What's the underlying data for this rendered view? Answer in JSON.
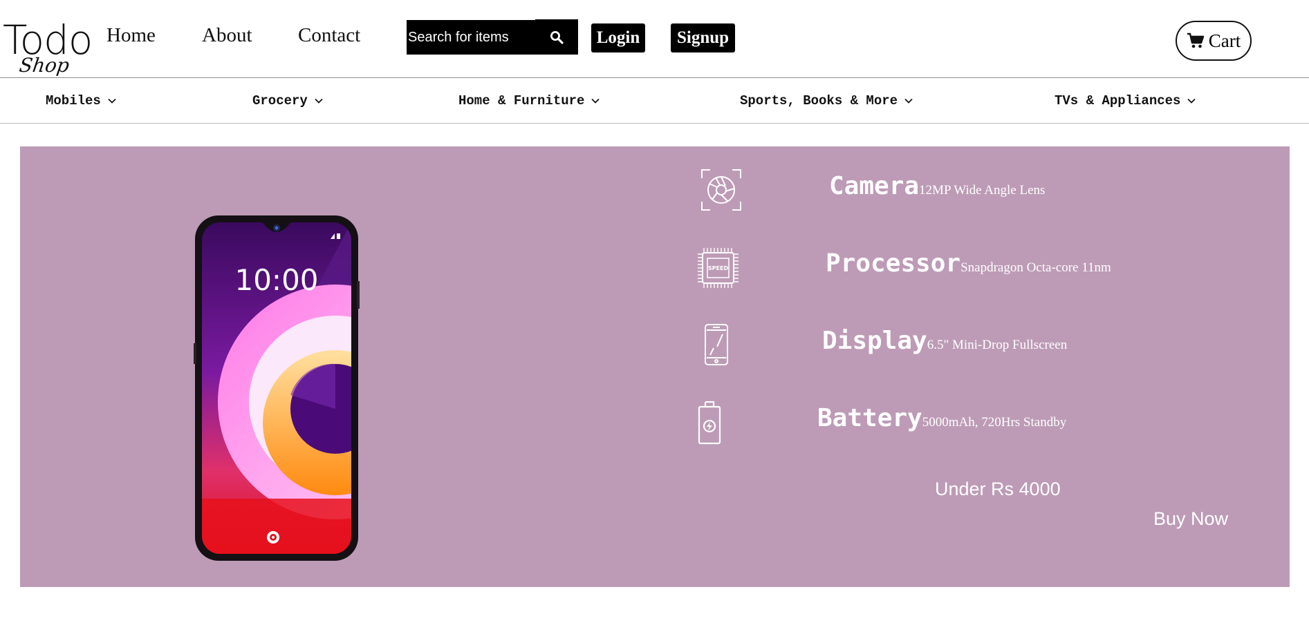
{
  "header": {
    "logo_main": "Todo",
    "logo_sub": "Shop",
    "nav": {
      "home": "Home",
      "about": "About",
      "contact": "Contact"
    },
    "search": {
      "placeholder": "Search for items",
      "value": ""
    },
    "login_label": "Login",
    "signup_label": "Signup",
    "cart_label": "Cart"
  },
  "categories": [
    {
      "label": "Mobiles",
      "icon": "chevron-down-icon"
    },
    {
      "label": "Grocery",
      "icon": "chevron-down-icon"
    },
    {
      "label": "Home & Furniture",
      "icon": "chevron-down-icon"
    },
    {
      "label": "Sports, Books & More",
      "icon": "chevron-down-icon"
    },
    {
      "label": "TVs & Appliances",
      "icon": "chevron-down-icon"
    }
  ],
  "banner": {
    "background_color": "#bd9bb6",
    "phone_clock": "10:00",
    "features": [
      {
        "title": "Camera",
        "desc": "12MP Wide Angle Lens",
        "icon": "camera-aperture-icon"
      },
      {
        "title": "Processor",
        "desc": "Snapdragon Octa-core 11nm",
        "icon": "processor-chip-icon",
        "chip_text": "SPEED"
      },
      {
        "title": "Display",
        "desc": "6.5\" Mini-Drop Fullscreen",
        "icon": "smartphone-icon"
      },
      {
        "title": "Battery",
        "desc": "5000mAh, 720Hrs Standby",
        "icon": "battery-icon"
      }
    ],
    "price": "Under Rs 4000",
    "buy_label": "Buy Now"
  }
}
